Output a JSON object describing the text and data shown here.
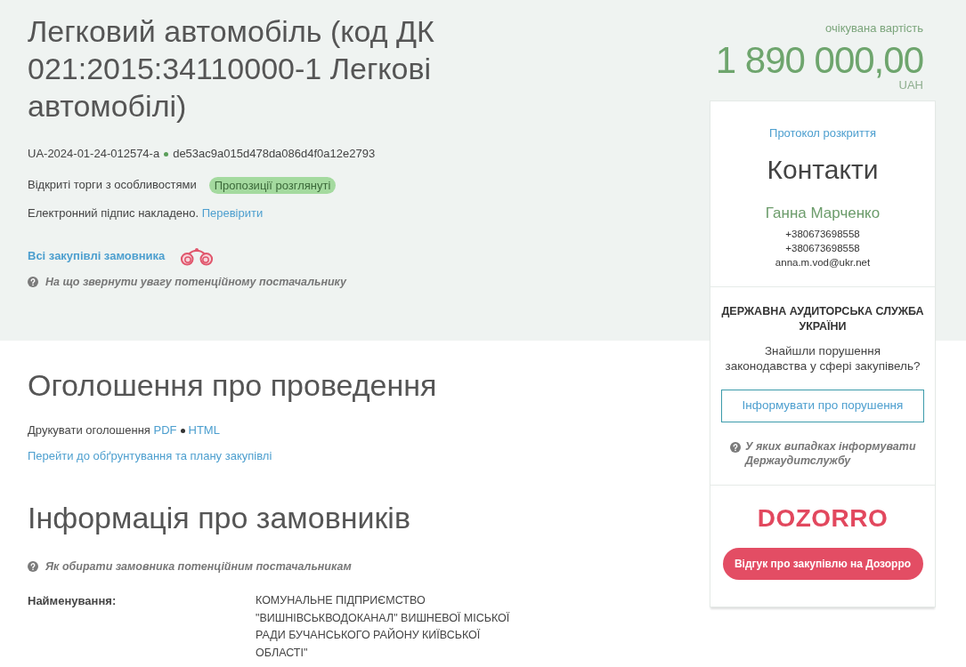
{
  "header": {
    "title": "Легковий автомобіль (код ДК 021:2015:34110000-1 Легкові автомобілі)",
    "tender_id": "UA-2024-01-24-012574-a",
    "hash": "de53ac9a015d478da086d4f0a12e2793",
    "procedure_type": "Відкриті торги з особливостями",
    "status_badge": "Пропозиції розглянуті",
    "signature_text": "Електронний підпис накладено.",
    "signature_link": "Перевірити",
    "buyer_tenders_link": "Всі закупівлі замовника",
    "supplier_hint": "На що звернути увагу потенційному постачальнику"
  },
  "value": {
    "label": "очікувана вартість",
    "amount": "1 890 000,00",
    "currency": "UAH"
  },
  "sidebar": {
    "protocol_link": "Протокол розкриття",
    "contacts_title": "Контакти",
    "contact_name": "Ганна Марченко",
    "phones": [
      "+380673698558",
      "+380673698558"
    ],
    "email": "anna.m.vod@ukr.net",
    "audit": {
      "title": "ДЕРЖАВНА АУДИТОРСЬКА СЛУЖБА УКРАЇНИ",
      "question": "Знайшли порушення законодавства у сфері закупівель?",
      "button": "Інформувати про порушення",
      "hint": "У яких випадках інформувати Держаудитслужбу"
    },
    "dozorro": {
      "logo": "DOZORRO",
      "button": "Відгук про закупівлю на Дозорро"
    }
  },
  "announcement": {
    "title": "Оголошення про проведення",
    "print_label": "Друкувати оголошення",
    "print_links": [
      "PDF",
      "HTML"
    ],
    "plan_link": "Перейти до обґрунтування та плану закупівлі"
  },
  "buyers": {
    "title": "Інформація про замовників",
    "hint": "Як обирати замовника потенційним постачальникам",
    "fields": [
      {
        "label": "Найменування:",
        "value": "КОМУНАЛЬНЕ ПІДПРИЄМСТВО \"ВИШНІВСЬКВОДОКАНАЛ\" ВИШНЕВОЇ МІСЬКОЇ РАДИ БУЧАНСЬКОГО РАЙОНУ КИЇВСЬКОЇ ОБЛАСТІ\""
      }
    ]
  }
}
